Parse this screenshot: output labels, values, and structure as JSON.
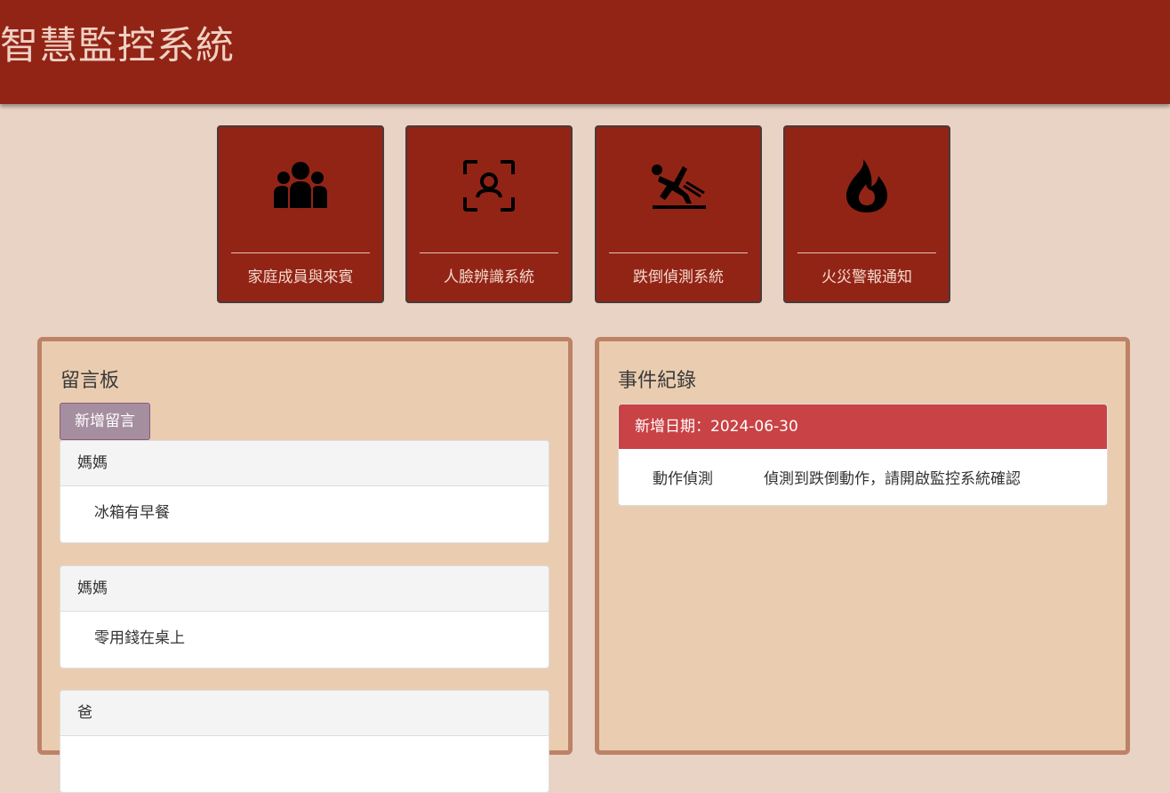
{
  "header": {
    "title": "智慧監控系統"
  },
  "tiles": [
    {
      "icon": "people-group-icon",
      "label": "家庭成員與來賓"
    },
    {
      "icon": "face-recognition-icon",
      "label": "人臉辨識系統"
    },
    {
      "icon": "person-falling-icon",
      "label": "跌倒偵測系統"
    },
    {
      "icon": "fire-icon",
      "label": "火災警報通知"
    }
  ],
  "message_board": {
    "title": "留言板",
    "add_button": "新增留言",
    "messages": [
      {
        "author": "媽媽",
        "content": "冰箱有早餐"
      },
      {
        "author": "媽媽",
        "content": "零用錢在桌上"
      },
      {
        "author": "爸",
        "content": ""
      }
    ]
  },
  "event_log": {
    "title": "事件紀錄",
    "date_header": "新增日期：2024-06-30",
    "events": [
      {
        "type": "動作偵測",
        "description": "偵測到跌倒動作，請開啟監控系統確認"
      }
    ]
  },
  "colors": {
    "header_bg": "#922416",
    "page_bg": "#e8d3c5",
    "panel_bg": "#eacdb0",
    "panel_border": "#bd8266",
    "event_header_bg": "#c94245",
    "add_button_bg": "#a58ea0"
  }
}
